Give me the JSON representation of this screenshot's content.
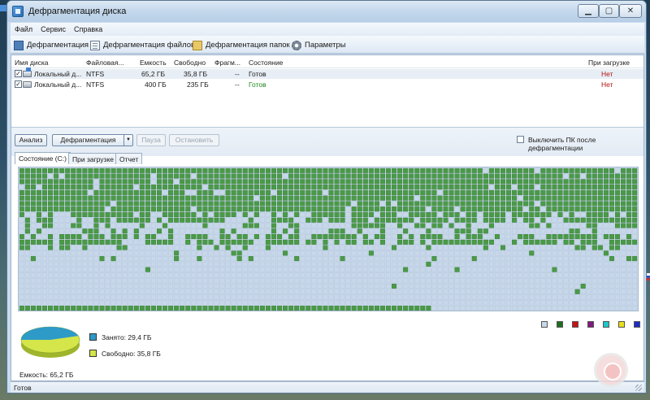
{
  "window": {
    "title": "Дефрагментация диска",
    "buttons": {
      "minimize": "▁",
      "maximize": "▢",
      "close": "✕"
    }
  },
  "menu": [
    "Файл",
    "Сервис",
    "Справка"
  ],
  "toolbar": {
    "defrag": "Дефрагментация",
    "defrag_files": "Дефрагментация файлов",
    "defrag_folders": "Дефрагментация папок",
    "settings": "Параметры"
  },
  "disk_list": {
    "columns": [
      "Имя диска",
      "Файловая...",
      "Емкость",
      "Свободно",
      "Фрагм...",
      "Состояние",
      "При загрузке"
    ],
    "rows": [
      {
        "name": "Локальный д...",
        "fs": "NTFS",
        "capacity": "65,2 ГБ",
        "free": "35,8 ГБ",
        "frag": "--",
        "state": "Готов",
        "boot": "Нет",
        "checked": true
      },
      {
        "name": "Локальный д...",
        "fs": "NTFS",
        "capacity": "400 ГБ",
        "free": "235 ГБ",
        "frag": "--",
        "state": "Готов",
        "boot": "Нет",
        "checked": true
      }
    ]
  },
  "controls": {
    "analyze": "Анализ",
    "defrag": "Дефрагментация",
    "pause": "Пауза",
    "stop": "Остановить",
    "shutdown_label": "Выключить ПК после дефрагментации"
  },
  "tabs": [
    "Состояние (C:)",
    "При загрузке",
    "Отчет"
  ],
  "colors": {
    "used": "#4a9a47",
    "free": "#c8d8ea",
    "legend": [
      "#c8d8ea",
      "#1f6e1f",
      "#c81414",
      "#801a80",
      "#1ec8c8",
      "#e8e01a",
      "#1c2cc8"
    ]
  },
  "pie": {
    "used_label": "Занято: 29,4 ГБ",
    "free_label": "Свободно: 35,8 ГБ",
    "used_gb": 29.4,
    "free_gb": 35.8,
    "used_color": "#2e9ac8",
    "free_color": "#d4e64a"
  },
  "capacity": "Емкость: 65,2 ГБ",
  "status": "Готов"
}
